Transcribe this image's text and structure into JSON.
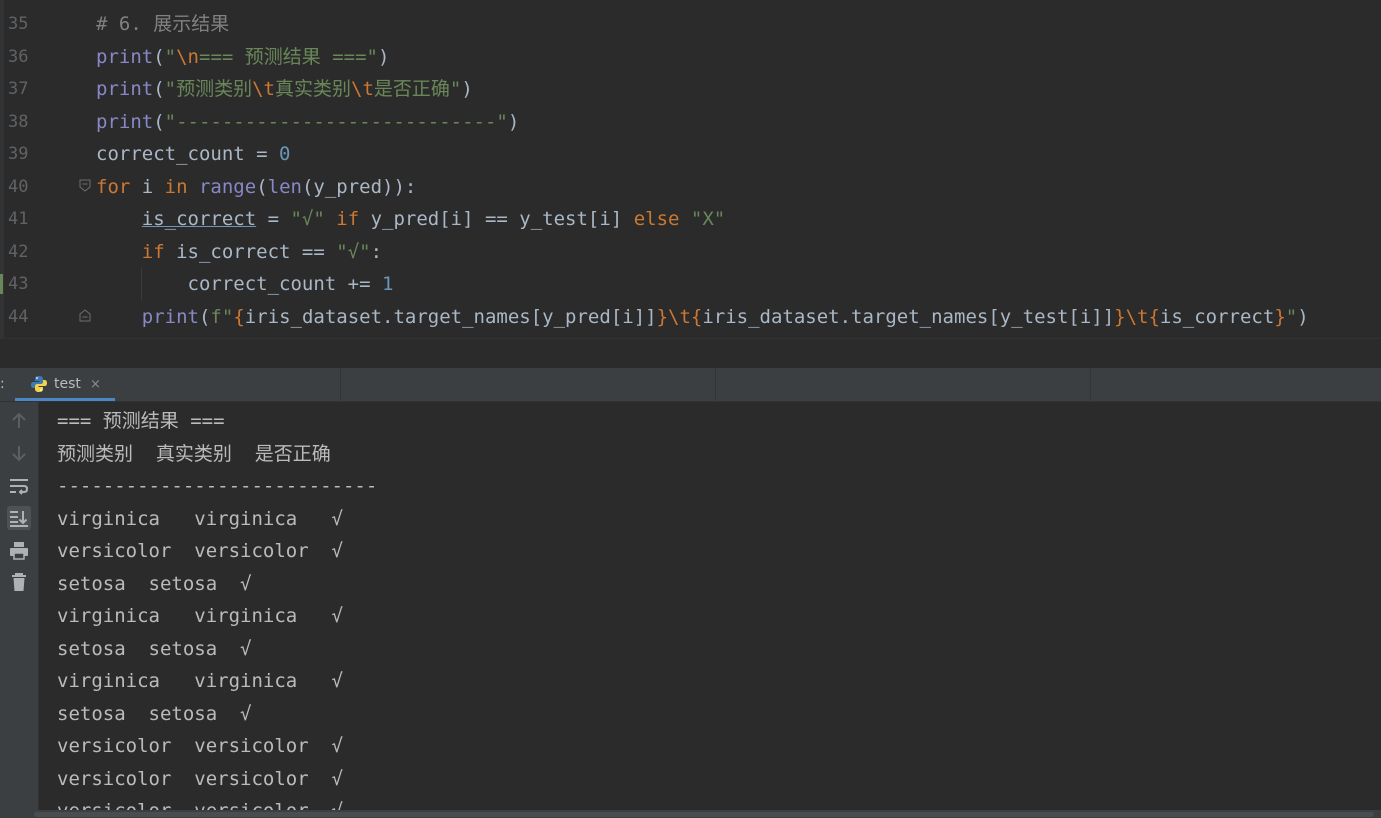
{
  "editor": {
    "lines": [
      {
        "num": "35",
        "tokens": [
          {
            "t": "# 6. 展示结果",
            "c": "cm"
          }
        ]
      },
      {
        "num": "36",
        "tokens": [
          {
            "t": "print",
            "c": "fn"
          },
          {
            "t": "(",
            "c": ""
          },
          {
            "t": "\"",
            "c": "st"
          },
          {
            "t": "\\n",
            "c": "es"
          },
          {
            "t": "=== 预测结果 ===\"",
            "c": "st"
          },
          {
            "t": ")",
            "c": ""
          }
        ]
      },
      {
        "num": "37",
        "tokens": [
          {
            "t": "print",
            "c": "fn"
          },
          {
            "t": "(",
            "c": ""
          },
          {
            "t": "\"预测类别",
            "c": "st"
          },
          {
            "t": "\\t",
            "c": "es"
          },
          {
            "t": "真实类别",
            "c": "st"
          },
          {
            "t": "\\t",
            "c": "es"
          },
          {
            "t": "是否正确\"",
            "c": "st"
          },
          {
            "t": ")",
            "c": ""
          }
        ]
      },
      {
        "num": "38",
        "tokens": [
          {
            "t": "print",
            "c": "fn"
          },
          {
            "t": "(",
            "c": ""
          },
          {
            "t": "\"----------------------------\"",
            "c": "st"
          },
          {
            "t": ")",
            "c": ""
          }
        ]
      },
      {
        "num": "39",
        "tokens": [
          {
            "t": "correct_count = ",
            "c": ""
          },
          {
            "t": "0",
            "c": "nm"
          }
        ]
      },
      {
        "num": "40",
        "tokens": [
          {
            "t": "for ",
            "c": "kw"
          },
          {
            "t": "i ",
            "c": ""
          },
          {
            "t": "in ",
            "c": "kw"
          },
          {
            "t": "range",
            "c": "fn"
          },
          {
            "t": "(",
            "c": ""
          },
          {
            "t": "len",
            "c": "fn"
          },
          {
            "t": "(y_pred)):",
            "c": ""
          }
        ]
      },
      {
        "num": "41",
        "tokens": [
          {
            "t": "    ",
            "c": ""
          },
          {
            "t": "is_correct",
            "c": "ul"
          },
          {
            "t": " = ",
            "c": ""
          },
          {
            "t": "\"√\"",
            "c": "st"
          },
          {
            "t": " if ",
            "c": "kw"
          },
          {
            "t": "y_pred[i] == y_test[i] ",
            "c": ""
          },
          {
            "t": "else ",
            "c": "kw"
          },
          {
            "t": "\"X\"",
            "c": "st"
          }
        ]
      },
      {
        "num": "42",
        "tokens": [
          {
            "t": "    ",
            "c": ""
          },
          {
            "t": "if ",
            "c": "kw"
          },
          {
            "t": "is_correct == ",
            "c": ""
          },
          {
            "t": "\"√\"",
            "c": "st"
          },
          {
            "t": ":",
            "c": ""
          }
        ]
      },
      {
        "num": "43",
        "tokens": [
          {
            "t": "        correct_count += ",
            "c": ""
          },
          {
            "t": "1",
            "c": "nm"
          }
        ]
      },
      {
        "num": "44",
        "tokens": [
          {
            "t": "    ",
            "c": ""
          },
          {
            "t": "print",
            "c": "fn"
          },
          {
            "t": "(",
            "c": ""
          },
          {
            "t": "f\"",
            "c": "st"
          },
          {
            "t": "{",
            "c": "es"
          },
          {
            "t": "iris_dataset.target_names[y_pred[i]]",
            "c": ""
          },
          {
            "t": "}\\t{",
            "c": "es"
          },
          {
            "t": "iris_dataset.target_names[y_test[i]]",
            "c": ""
          },
          {
            "t": "}\\t{",
            "c": "es"
          },
          {
            "t": "is_correct",
            "c": ""
          },
          {
            "t": "}",
            "c": "es"
          },
          {
            "t": "\"",
            "c": "st"
          },
          {
            "t": ")",
            "c": ""
          }
        ]
      }
    ]
  },
  "run_panel": {
    "colon": ":",
    "tab_label": "test",
    "tab_close": "×",
    "toolbar_icons": [
      "up-arrow-icon",
      "down-arrow-icon",
      "soft-wrap-icon",
      "scroll-to-end-icon",
      "print-icon",
      "trash-icon"
    ]
  },
  "console": {
    "lines": [
      "=== 预测结果 ===",
      "预测类别  真实类别  是否正确",
      "----------------------------",
      "virginica   virginica   √",
      "versicolor  versicolor  √",
      "setosa  setosa  √",
      "virginica   virginica   √",
      "setosa  setosa  √",
      "virginica   virginica   √",
      "setosa  setosa  √",
      "versicolor  versicolor  √",
      "versicolor  versicolor  √",
      "versicolor  versicolor  √"
    ]
  },
  "colors": {
    "background": "#2b2b2b",
    "panel": "#3c3f41",
    "keyword": "#cc7832",
    "string": "#6a8759",
    "builtin": "#8888c6",
    "number": "#6897bb",
    "comment": "#808080",
    "tab_accent": "#4a88c7"
  }
}
